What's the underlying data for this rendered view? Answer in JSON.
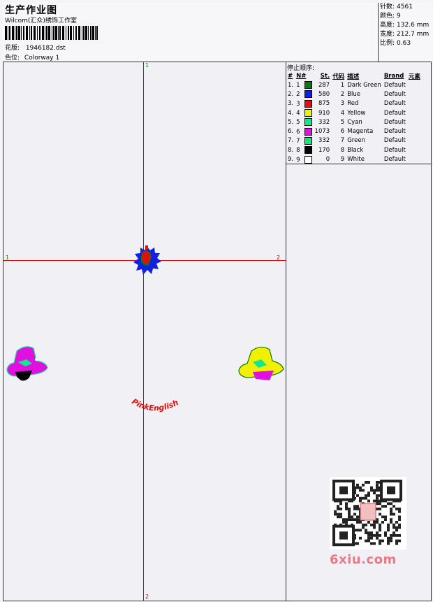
{
  "header": {
    "title": "生产作业图",
    "subtitle": "Wilcom(汇众)绣饰工作室",
    "pattern_label": "花版:",
    "pattern_value": "1946182.dst",
    "colorway_label": "色位:",
    "colorway_value": "Colorway 1"
  },
  "stats": [
    {
      "label": "针数:",
      "value": "4561"
    },
    {
      "label": "颜色:",
      "value": "9"
    },
    {
      "label": "高度:",
      "value": "132.6 mm"
    },
    {
      "label": "宽度:",
      "value": "212.7 mm"
    },
    {
      "label": "比例:",
      "value": "0.63"
    }
  ],
  "stop_sequence": {
    "title": "停止顺序:",
    "columns": [
      "#",
      "N#",
      "St.",
      "代码",
      "描述",
      "Brand",
      "元素"
    ],
    "rows": [
      {
        "idx": "1.",
        "n": "1",
        "color": "#0a7a0a",
        "st": "287",
        "code": "1",
        "desc": "Dark Green",
        "brand": "Default"
      },
      {
        "idx": "2.",
        "n": "2",
        "color": "#1020e0",
        "st": "580",
        "code": "2",
        "desc": "Blue",
        "brand": "Default"
      },
      {
        "idx": "3.",
        "n": "3",
        "color": "#e01010",
        "st": "875",
        "code": "3",
        "desc": "Red",
        "brand": "Default"
      },
      {
        "idx": "4.",
        "n": "4",
        "color": "#f0f000",
        "st": "910",
        "code": "4",
        "desc": "Yellow",
        "brand": "Default"
      },
      {
        "idx": "5.",
        "n": "5",
        "color": "#10e890",
        "st": "332",
        "code": "5",
        "desc": "Cyan",
        "brand": "Default"
      },
      {
        "idx": "6.",
        "n": "6",
        "color": "#e010e0",
        "st": "1073",
        "code": "6",
        "desc": "Magenta",
        "brand": "Default"
      },
      {
        "idx": "7.",
        "n": "7",
        "color": "#10e880",
        "st": "332",
        "code": "7",
        "desc": "Green",
        "brand": "Default"
      },
      {
        "idx": "8.",
        "n": "8",
        "color": "#000000",
        "st": "170",
        "code": "8",
        "desc": "Black",
        "brand": "Default"
      },
      {
        "idx": "9.",
        "n": "9",
        "color": "#ffffff",
        "st": "0",
        "code": "9",
        "desc": "White",
        "brand": "Default"
      }
    ]
  },
  "axes": {
    "top": "1",
    "bottom": "2",
    "left": "1",
    "right": "2"
  },
  "design_text": "PinkEnglish",
  "watermark": "6xiu.com"
}
